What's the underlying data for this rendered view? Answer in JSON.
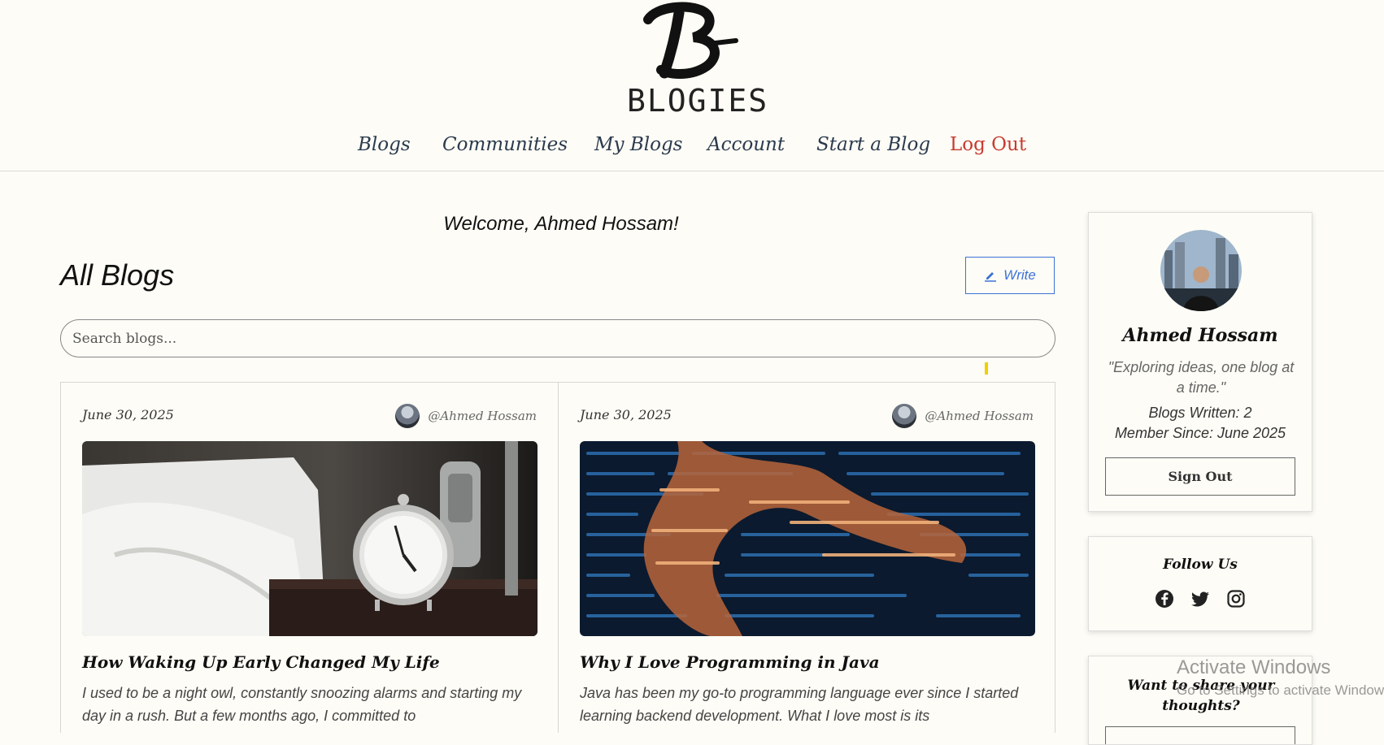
{
  "header": {
    "logo_text": "BLOGIES",
    "nav": [
      {
        "label": "Blogs"
      },
      {
        "label": "Communities"
      },
      {
        "label": "My Blogs"
      },
      {
        "label": "Account"
      },
      {
        "label": "Start a Blog"
      },
      {
        "label": "Log Out"
      }
    ]
  },
  "main": {
    "welcome": "Welcome, Ahmed Hossam!",
    "title": "All Blogs",
    "write_label": "Write",
    "search_placeholder": "Search blogs...",
    "cards": [
      {
        "date": "June 30, 2025",
        "author": "@Ahmed Hossam",
        "title": "How Waking Up Early Changed My Life",
        "excerpt": "I used to be a night owl, constantly snoozing alarms and starting my day in a rush. But a few months ago, I committed to"
      },
      {
        "date": "June 30, 2025",
        "author": "@Ahmed Hossam",
        "title": "Why I Love Programming in Java",
        "excerpt": "Java has been my go-to programming language ever since I started learning backend development. What I love most is its"
      }
    ]
  },
  "sidebar": {
    "profile": {
      "name": "Ahmed Hossam",
      "quote": "\"Exploring ideas, one blog at a time.\"",
      "blogs_written": "Blogs Written: 2",
      "member_since": "Member Since: June 2025",
      "signout_label": "Sign Out"
    },
    "follow": {
      "title": "Follow Us",
      "icons": [
        "facebook-icon",
        "twitter-icon",
        "instagram-icon"
      ]
    },
    "share": {
      "title": "Want to share your thoughts?"
    }
  },
  "watermark": {
    "line1": "Activate Windows",
    "line2": "Go to Settings to activate Windows."
  },
  "colors": {
    "background": "#fdfcf6",
    "accent_blue": "#3d72d8",
    "logout_red": "#c83a30",
    "nav_text": "#2b3a4d"
  }
}
